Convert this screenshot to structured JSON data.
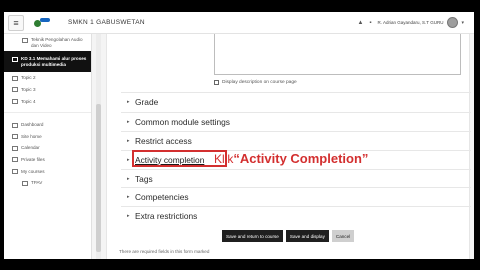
{
  "header": {
    "menu_icon": "hamburger-icon",
    "site_name": "SMKN 1 GABUSWETAN",
    "notification_icon": "bell-icon",
    "message_icon": "chat-icon",
    "user_name": "R. Adrian Gayandaru, S.T GURU",
    "user_menu_caret": "▾"
  },
  "sidebar": {
    "items": [
      {
        "label": "Teknik Pengolahan Audio dan Video",
        "active": false
      },
      {
        "label": "KD 3.1 Memahami alur proses produksi multimedia",
        "active": true
      },
      {
        "label": "Topic 2",
        "active": false
      },
      {
        "label": "Topic 3",
        "active": false
      },
      {
        "label": "Topic 4",
        "active": false
      }
    ],
    "nav": [
      {
        "label": "Dashboard",
        "icon": "dashboard-icon"
      },
      {
        "label": "Site home",
        "icon": "home-icon"
      },
      {
        "label": "Calendar",
        "icon": "calendar-icon"
      },
      {
        "label": "Private files",
        "icon": "file-icon"
      },
      {
        "label": "My courses",
        "icon": "graduation-cap-icon"
      },
      {
        "label": "TPAV",
        "icon": "course-icon"
      }
    ]
  },
  "form": {
    "display_description_label": "Display description on course page",
    "sections": [
      {
        "label": "Grade"
      },
      {
        "label": "Common module settings"
      },
      {
        "label": "Restrict access"
      },
      {
        "label": "Activity completion"
      },
      {
        "label": "Tags"
      },
      {
        "label": "Competencies"
      },
      {
        "label": "Extra restrictions"
      }
    ],
    "buttons": {
      "save_return": "Save and return to course",
      "save_display": "Save and display",
      "cancel": "Cancel"
    },
    "required_note": "There are required fields in this form marked"
  },
  "annotation": {
    "prefix": "Klik",
    "quoted": "“Activity Completion”"
  },
  "colors": {
    "highlight_red": "#d32f2f",
    "button_primary": "#1f1f1f",
    "active_sidebar": "#111111"
  }
}
